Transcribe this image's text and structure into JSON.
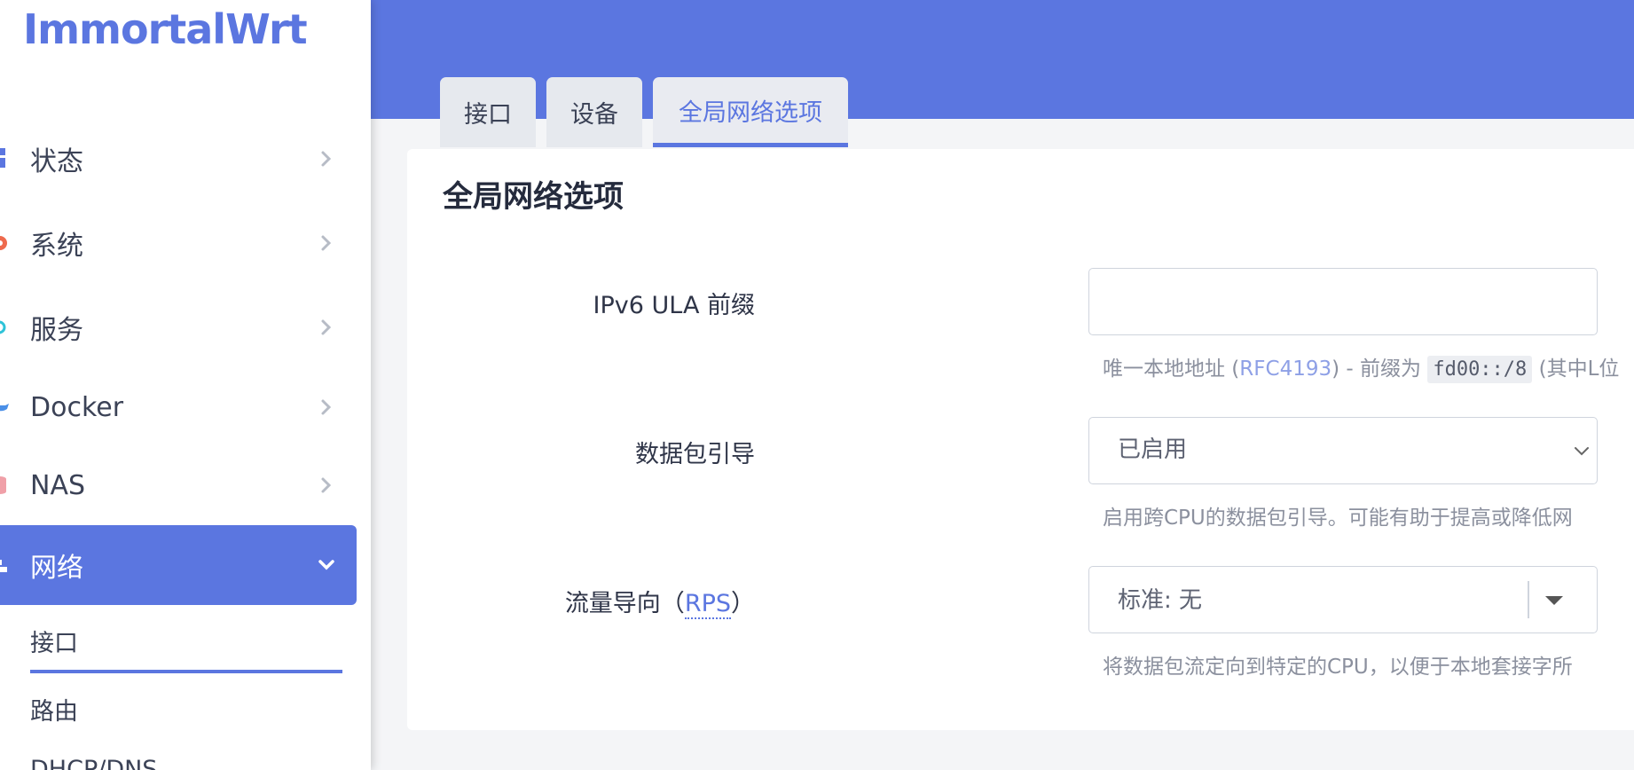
{
  "app": {
    "logo_text": "ImmortalWrt",
    "brand_color": "#5b76e0"
  },
  "sidebar": {
    "items": [
      {
        "label": "状态",
        "icon": "dashboard-icon"
      },
      {
        "label": "系统",
        "icon": "gear-icon"
      },
      {
        "label": "服务",
        "icon": "cog-icon"
      },
      {
        "label": "Docker",
        "icon": "docker-icon"
      },
      {
        "label": "NAS",
        "icon": "database-icon"
      },
      {
        "label": "网络",
        "icon": "network-icon",
        "expanded": true
      }
    ],
    "subitems": [
      {
        "label": "接口",
        "active": true
      },
      {
        "label": "路由"
      },
      {
        "label": "DHCP/DNS"
      }
    ]
  },
  "tabs": [
    {
      "label": "接口"
    },
    {
      "label": "设备"
    },
    {
      "label": "全局网络选项",
      "active": true
    }
  ],
  "panel": {
    "title": "全局网络选项",
    "ula": {
      "label": "IPv6 ULA 前缀",
      "value": "",
      "help_prefix": "唯一本地地址 (",
      "help_link": "RFC4193",
      "help_mid": ") - 前缀为",
      "help_code": "fd00::/8",
      "help_suffix": "(其中L位"
    },
    "packet_steering": {
      "label": "数据包引导",
      "value": "已启用",
      "help": "启用跨CPU的数据包引导。可能有助于提高或降低网"
    },
    "rps": {
      "label_prefix": "流量导向（",
      "label_link": "RPS",
      "label_suffix": "）",
      "value": "标准: 无",
      "help": "将数据包流定向到特定的CPU，以便于本地套接字所"
    }
  }
}
